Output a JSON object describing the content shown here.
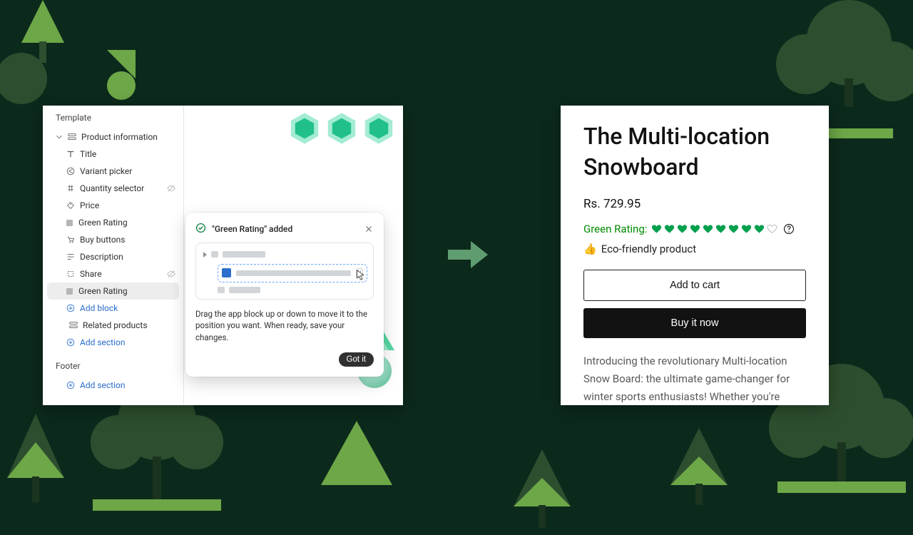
{
  "editor": {
    "template_heading": "Template",
    "footer_heading": "Footer",
    "product_info": "Product information",
    "items": [
      {
        "label": "Title"
      },
      {
        "label": "Variant picker"
      },
      {
        "label": "Quantity selector"
      },
      {
        "label": "Price"
      },
      {
        "label": "Green Rating"
      },
      {
        "label": "Buy buttons"
      },
      {
        "label": "Description"
      },
      {
        "label": "Share"
      },
      {
        "label": "Green Rating"
      }
    ],
    "add_block": "Add block",
    "related_products": "Related products",
    "add_section": "Add section"
  },
  "callout": {
    "title": "\"Green Rating\" added",
    "body": "Drag the app block up or down to move it to the position you want. When ready, save your changes.",
    "button": "Got it"
  },
  "product": {
    "title": "The Multi-location Snowboard",
    "price": "Rs. 729.95",
    "green_rating_label": "Green Rating:",
    "rating_filled": 9,
    "rating_total": 10,
    "eco_text": "Eco-friendly product",
    "add_to_cart": "Add to cart",
    "buy_now": "Buy it now",
    "description": "Introducing the revolutionary Multi-location Snow Board: the ultimate game-changer for winter sports enthusiasts! Whether you're"
  },
  "colors": {
    "heart_fill": "#00a04d",
    "heart_empty": "#c9c9c9",
    "accent_blue": "#2c6ecb"
  }
}
